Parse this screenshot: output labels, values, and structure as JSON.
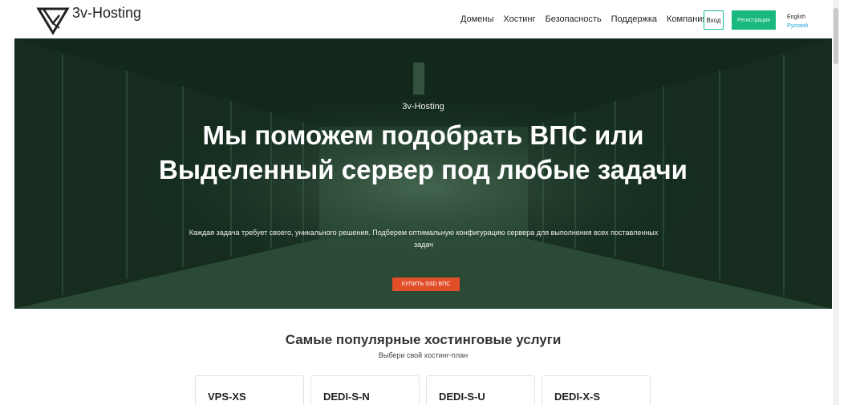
{
  "header": {
    "logo_text": "3v-Hosting",
    "nav": [
      "Домены",
      "Хостинг",
      "Безопасность",
      "Поддержка",
      "Компания"
    ],
    "login_label": "Вход",
    "register_label": "Регистрация",
    "lang_en": "English",
    "lang_ru": "Русский"
  },
  "hero": {
    "brand": "3v-Hosting",
    "title": "Мы поможем подобрать ВПС или Выделенный сервер под любые задачи",
    "subtitle": "Каждая задача требует своего, уникального решения. Подберем оптимальную конфигурацию сервера для выполнения всех поставленных задач",
    "cta_label": "КУПИТЬ SSD ВПС"
  },
  "section": {
    "title": "Самые популярные хостинговые услуги",
    "subtitle": "Выбери свой хостинг-план",
    "cards": [
      "VPS-XS",
      "DEDI-S-N",
      "DEDI-S-U",
      "DEDI-X-S"
    ]
  },
  "colors": {
    "accent_green": "#1ab87f",
    "cta_orange": "#e14e2a",
    "lang_link": "#1aa1d6",
    "hero_overlay": "#2a4534"
  }
}
